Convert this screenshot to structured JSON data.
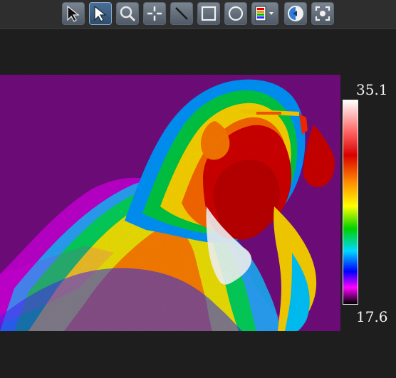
{
  "toolbar": {
    "tools": [
      {
        "name": "select-arrow-tool",
        "icon": "arrow-cursor-icon"
      },
      {
        "name": "select-arrow-tool-active",
        "icon": "arrow-cursor-icon"
      },
      {
        "name": "zoom-tool",
        "icon": "magnifier-icon"
      },
      {
        "name": "crosshair-tool",
        "icon": "crosshair-icon"
      },
      {
        "name": "line-tool",
        "icon": "line-icon"
      },
      {
        "name": "rectangle-tool",
        "icon": "rectangle-icon"
      },
      {
        "name": "circle-tool",
        "icon": "circle-icon"
      },
      {
        "name": "palette-dropdown-tool",
        "icon": "palette-icon"
      },
      {
        "name": "toggle-tool",
        "icon": "half-circle-icon"
      },
      {
        "name": "fit-tool",
        "icon": "focus-icon"
      }
    ]
  },
  "temperature_scale": {
    "max": "35.1",
    "min": "17.6"
  },
  "colors": {
    "background": "#1e1e1e",
    "toolbar_background": "#2e2e2e",
    "palette": [
      "#ffffff",
      "#ff5f5f",
      "#d90000",
      "#ff8a00",
      "#ffff00",
      "#00d000",
      "#00d8ff",
      "#0000ff",
      "#ff00ff",
      "#000000"
    ]
  }
}
